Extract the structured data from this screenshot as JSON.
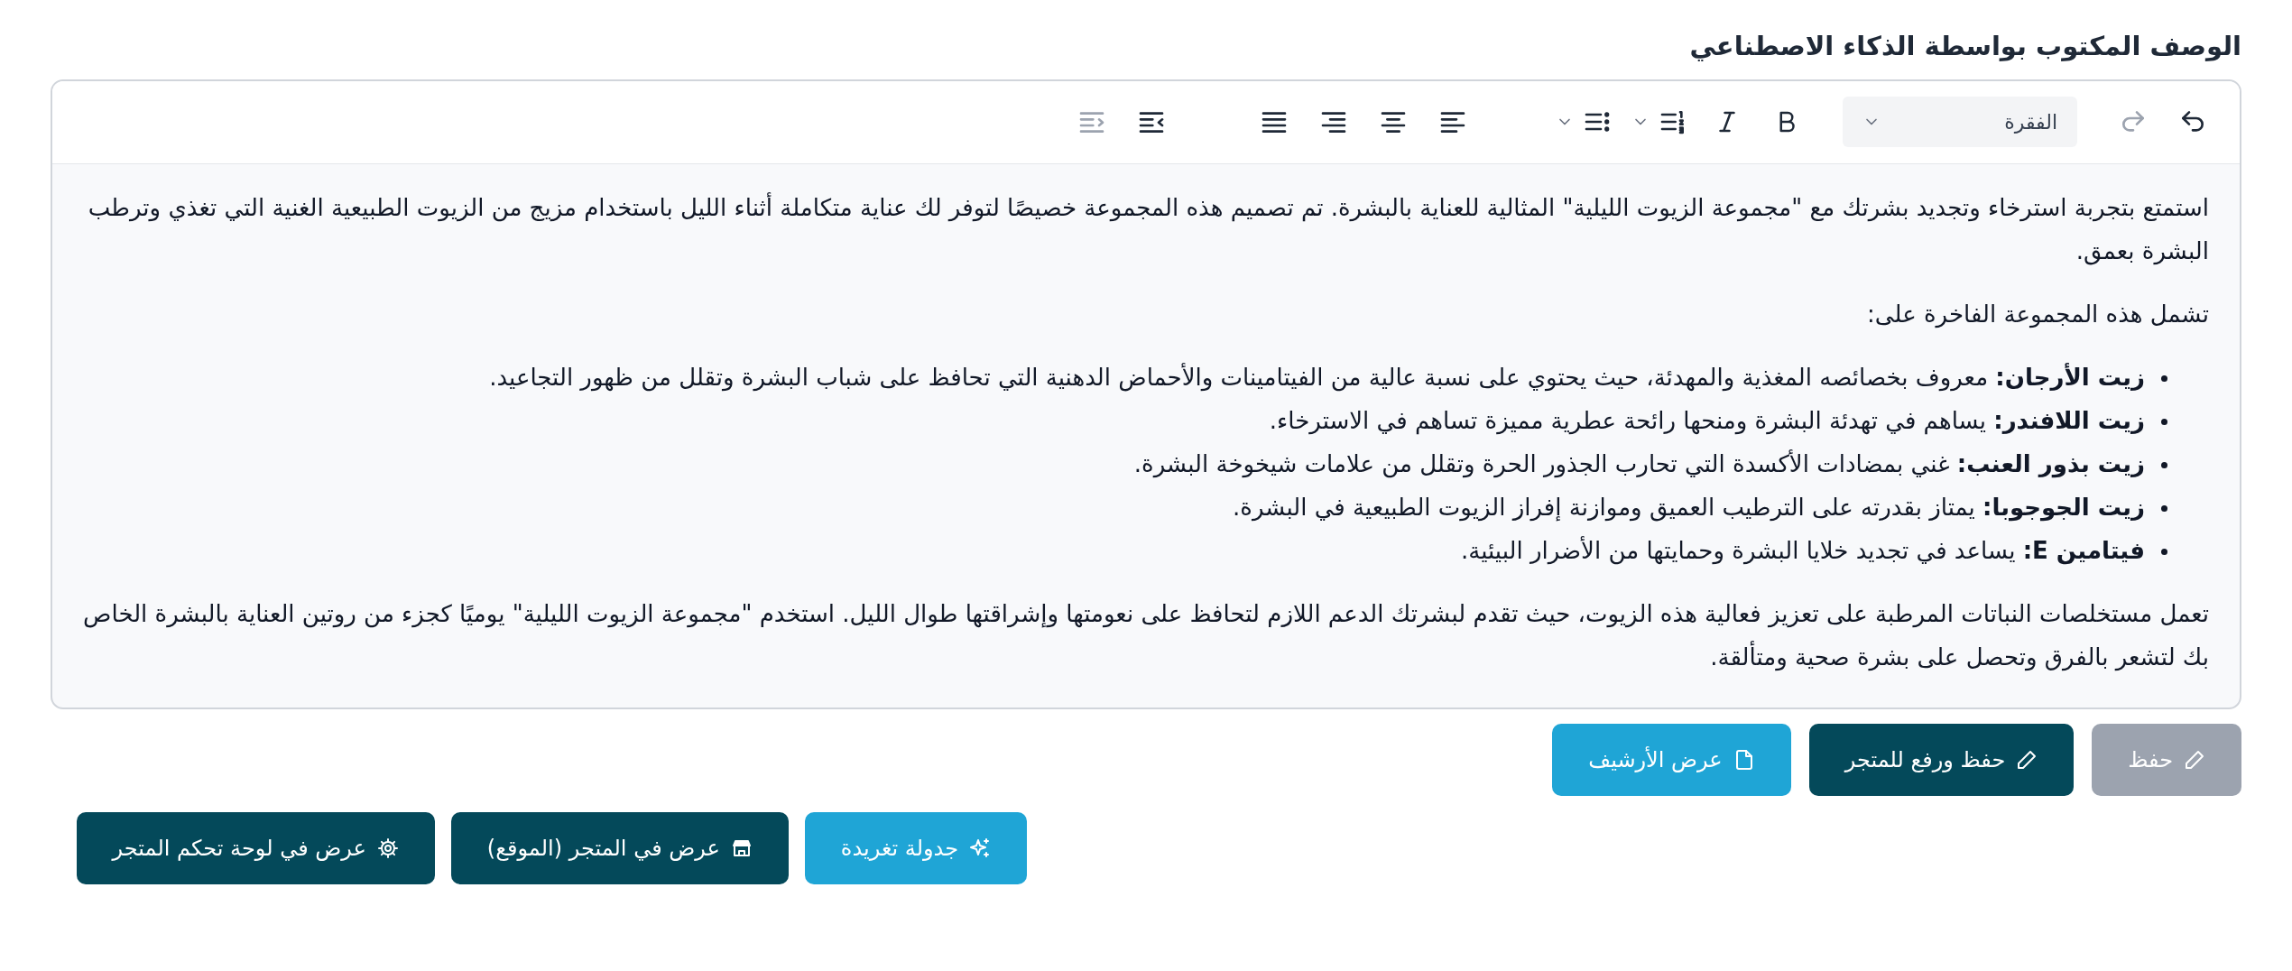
{
  "title": "الوصف المكتوب بواسطة الذكاء الاصطناعي",
  "toolbar": [
    {
      "kind": "undo",
      "disabled": false
    },
    {
      "kind": "redo",
      "disabled": true
    },
    {
      "kind": "select",
      "value": "الفقرة"
    },
    {
      "kind": "bold",
      "disabled": false
    },
    {
      "kind": "italic",
      "disabled": false
    },
    {
      "kind": "numbered-list",
      "disabled": false
    },
    {
      "kind": "bullet-list",
      "disabled": false
    },
    {
      "kind": "align-left",
      "disabled": false
    },
    {
      "kind": "align-center",
      "disabled": false
    },
    {
      "kind": "align-right",
      "disabled": false
    },
    {
      "kind": "justify",
      "disabled": false
    },
    {
      "kind": "outdent",
      "disabled": false
    },
    {
      "kind": "indent",
      "disabled": true
    }
  ],
  "content": [
    {
      "kind": "paragraph",
      "text": "استمتع بتجربة استرخاء وتجديد بشرتك مع \"مجموعة الزيوت الليلية\" المثالية للعناية بالبشرة. تم تصميم هذه المجموعة خصيصًا لتوفر لك عناية متكاملة أثناء الليل باستخدام مزيج من الزيوت الطبيعية الغنية التي تغذي وترطب البشرة بعمق."
    },
    {
      "kind": "paragraph",
      "text": "تشمل هذه المجموعة الفاخرة على:"
    },
    {
      "kind": "list",
      "items": [
        "**زيت الأرجان:** معروف بخصائصه المغذية والمهدئة، حيث يحتوي على نسبة عالية من الفيتامينات والأحماض الدهنية التي تحافظ على شباب البشرة وتقلل من ظهور التجاعيد.",
        "**زيت اللافندر:** يساهم في تهدئة البشرة ومنحها رائحة عطرية مميزة تساهم في الاسترخاء.",
        "**زيت بذور العنب:** غني بمضادات الأكسدة التي تحارب الجذور الحرة وتقلل من علامات شيخوخة البشرة.",
        "**زيت الجوجوبا:** يمتاز بقدرته على الترطيب العميق وموازنة إفراز الزيوت الطبيعية في البشرة.",
        "**فيتامين E:** يساعد في تجديد خلايا البشرة وحمايتها من الأضرار البيئية."
      ]
    },
    {
      "kind": "paragraph",
      "text": "تعمل مستخلصات النباتات المرطبة على تعزيز فعالية هذه الزيوت، حيث تقدم لبشرتك الدعم اللازم لتحافظ على نعومتها وإشراقتها طوال الليل. استخدم \"مجموعة الزيوت الليلية\" يوميًا كجزء من روتين العناية بالبشرة الخاص بك لتشعر بالفرق وتحصل على بشرة صحية ومتألقة."
    }
  ],
  "button_rows": [
    [
      {
        "label": "حفظ",
        "disabled": true
      },
      {
        "label": "حفظ ورفع للمتجر",
        "disabled": false
      },
      {
        "label": "عرض الأرشيف",
        "disabled": false
      }
    ],
    [
      {
        "label": "جدولة تغريدة",
        "disabled": false
      },
      {
        "label": "عرض في المتجر (الموقع)",
        "disabled": false
      },
      {
        "label": "عرض في لوحة تحكم المتجر",
        "disabled": false
      }
    ]
  ]
}
